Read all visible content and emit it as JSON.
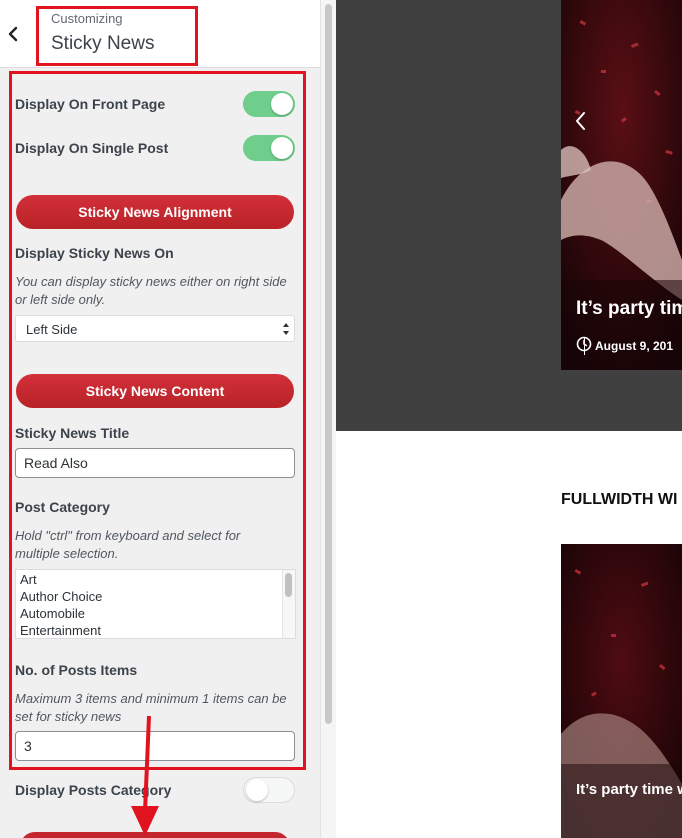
{
  "header": {
    "customizing_label": "Customizing",
    "section_title": "Sticky News",
    "back_icon": "chevron-left-icon"
  },
  "sidebar": {
    "display_front_page": {
      "label": "Display On Front Page",
      "enabled": true
    },
    "display_single_post": {
      "label": "Display On Single Post",
      "enabled": true
    },
    "alignment_button": "Sticky News Alignment",
    "display_on": {
      "label": "Display Sticky News On",
      "description": "You can display sticky news either on right side or left side only.",
      "selected": "Left Side"
    },
    "content_button": "Sticky News Content",
    "title_field": {
      "label": "Sticky News Title",
      "value": "Read Also"
    },
    "post_category": {
      "label": "Post Category",
      "description": "Hold \"ctrl\" from keyboard and select for multiple selection.",
      "options": [
        "Art",
        "Author Choice",
        "Automobile",
        "Entertainment"
      ]
    },
    "posts_items": {
      "label": "No. of Posts Items",
      "description": "Maximum 3 items and minimum 1 items can be set for sticky news",
      "value": "3"
    },
    "display_posts_category": {
      "label": "Display Posts Category",
      "enabled": false
    }
  },
  "preview": {
    "slide_title": "It’s party tim",
    "slide_date": "August 9, 201",
    "section_heading": "FULLWIDTH WI",
    "card_title": "It’s party time w",
    "icons": {
      "clock": "clock-icon",
      "prev": "chevron-left-icon"
    }
  },
  "colors": {
    "accent_red": "#c4262e",
    "annotation_red": "#e0131f",
    "toggle_on": "#6fce8b"
  }
}
